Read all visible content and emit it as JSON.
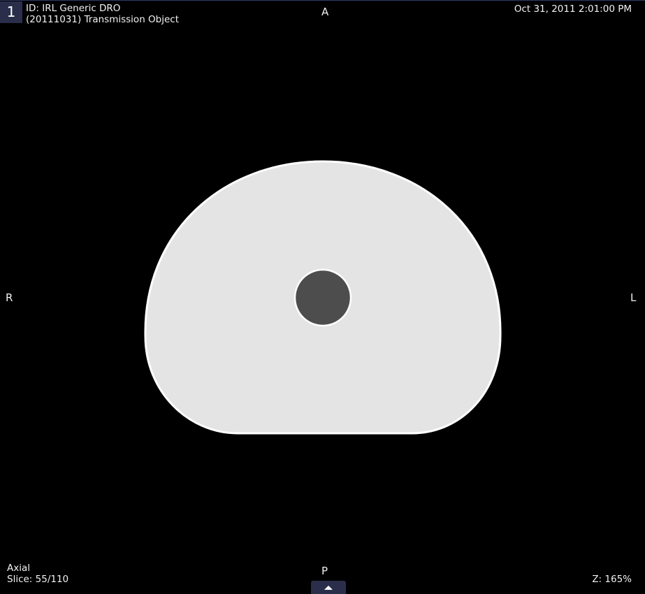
{
  "viewport": {
    "index": "1",
    "patient_id": "ID: IRL Generic DRO",
    "series_description": "(20111031) Transmission Object",
    "datetime": "Oct 31, 2011 2:01:00 PM",
    "orientation_plane": "Axial",
    "slice": "Slice: 55/110",
    "zoom": "Z: 165%"
  },
  "orientation_markers": {
    "top": "A",
    "bottom": "P",
    "left": "R",
    "right": "L"
  },
  "icons": {
    "expand_toolbar": "chevron-up-icon"
  },
  "colors": {
    "background": "#000000",
    "phantom_fill": "#e4e4e4",
    "phantom_outline": "#ffffff",
    "insert_fill": "#4d4d4d",
    "index_badge": "#2a2e4a"
  }
}
